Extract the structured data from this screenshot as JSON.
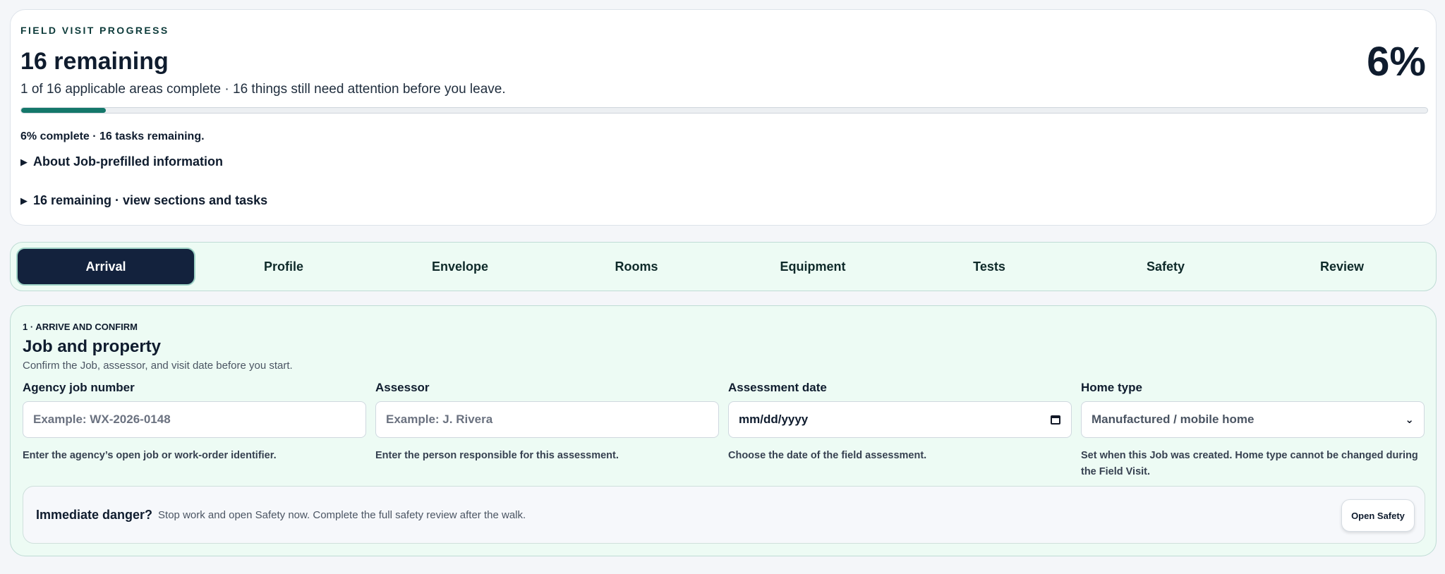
{
  "progress": {
    "eyebrow": "FIELD VISIT PROGRESS",
    "title": "16 remaining",
    "percent_label": "6%",
    "percent_value": 6,
    "summary": "1 of 16 applicable areas complete · 16 things still need attention before you leave.",
    "bar_caption": "6% complete · 16 tasks remaining.",
    "accent_color": "#14776a",
    "disclosures": [
      {
        "label": "About Job-prefilled information"
      },
      {
        "label": "16 remaining · view sections and tasks"
      }
    ]
  },
  "tabs": [
    {
      "label": "Arrival",
      "active": true
    },
    {
      "label": "Profile"
    },
    {
      "label": "Envelope"
    },
    {
      "label": "Rooms"
    },
    {
      "label": "Equipment"
    },
    {
      "label": "Tests"
    },
    {
      "label": "Safety"
    },
    {
      "label": "Review"
    }
  ],
  "section": {
    "eyebrow": "1 · ARRIVE AND CONFIRM",
    "title": "Job and property",
    "description": "Confirm the Job, assessor, and visit date before you start.",
    "fields": {
      "job_number": {
        "label": "Agency job number",
        "placeholder": "Example: WX-2026-0148",
        "help": "Enter the agency’s open job or work-order identifier."
      },
      "assessor": {
        "label": "Assessor",
        "placeholder": "Example: J. Rivera",
        "help": "Enter the person responsible for this assessment."
      },
      "date": {
        "label": "Assessment date",
        "value": "mm/dd/yyyy",
        "help": "Choose the date of the field assessment."
      },
      "home_type": {
        "label": "Home type",
        "value": "Manufactured / mobile home",
        "help": "Set when this Job was created. Home type cannot be changed during the Field Visit."
      }
    },
    "danger": {
      "lead": "Immediate danger?",
      "message": "Stop work and open Safety now. Complete the full safety review after the walk.",
      "button": "Open Safety"
    }
  }
}
